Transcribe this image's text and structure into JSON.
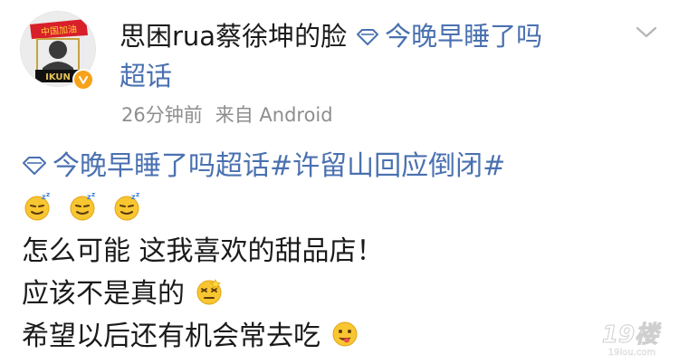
{
  "header": {
    "username": "思困rua蔡徐坤的脸",
    "topic_name_part1": "今晚早睡了吗",
    "topic_name_part2": "超话",
    "avatar_caption": "IKUN",
    "avatar_banner": "中国加油"
  },
  "meta": {
    "time": "26分钟前",
    "source": "来自 Android"
  },
  "post": {
    "topic_tag": "今晚早睡了吗超话",
    "hashtag": "#许留山回应倒闭#",
    "line2_emojis": [
      "sleepy-emoji",
      "sleepy-emoji",
      "sleepy-emoji"
    ],
    "line3": "怎么可能 这我喜欢的甜品店！",
    "line4": "应该不是真的",
    "line4_emoji": "dizzy-emoji",
    "line5": "希望以后还有机会常去吃",
    "line5_emoji": "drooling-emoji"
  },
  "watermark": {
    "text_big": "19楼",
    "text_small": "19lou.com"
  },
  "colors": {
    "link": "#4a71b0",
    "meta": "#8e8e8e",
    "text": "#1a1a1a",
    "badge": "#f7a21b"
  }
}
